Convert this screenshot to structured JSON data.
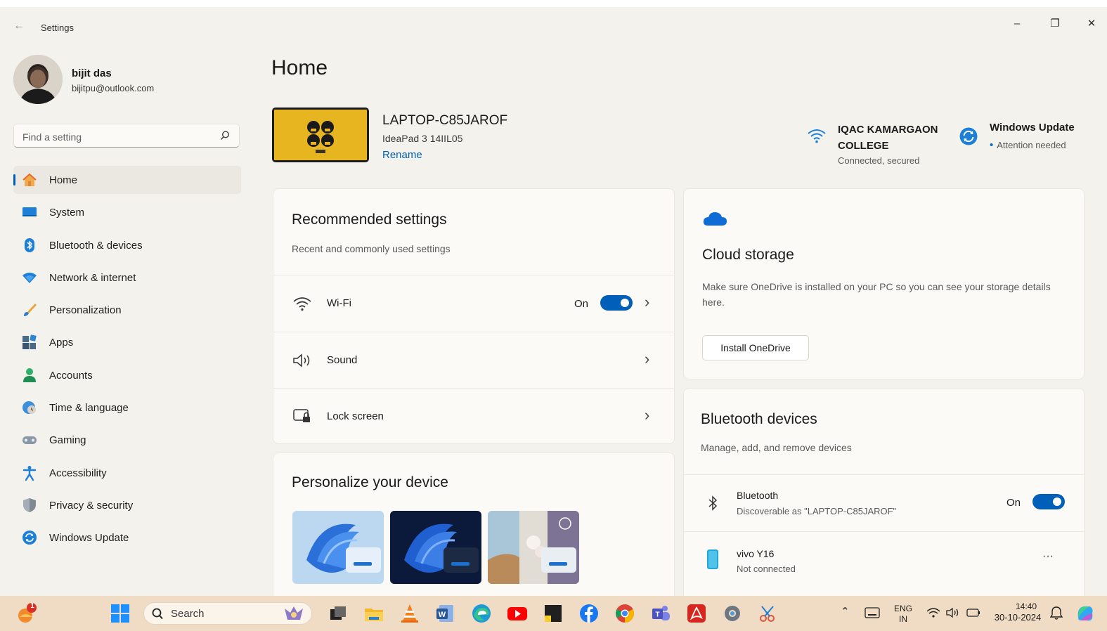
{
  "window": {
    "title": "Settings",
    "controls": [
      "–",
      "❐",
      "✕"
    ]
  },
  "profile": {
    "name": "bijit das",
    "email": "bijitpu@outlook.com"
  },
  "search": {
    "placeholder": "Find a setting"
  },
  "nav": {
    "items": [
      {
        "label": "Home",
        "icon": "home-icon",
        "active": true
      },
      {
        "label": "System",
        "icon": "system-icon"
      },
      {
        "label": "Bluetooth & devices",
        "icon": "bluetooth-icon"
      },
      {
        "label": "Network & internet",
        "icon": "network-icon"
      },
      {
        "label": "Personalization",
        "icon": "brush-icon"
      },
      {
        "label": "Apps",
        "icon": "apps-icon"
      },
      {
        "label": "Accounts",
        "icon": "account-icon"
      },
      {
        "label": "Time & language",
        "icon": "globe-clock-icon"
      },
      {
        "label": "Gaming",
        "icon": "gamepad-icon"
      },
      {
        "label": "Accessibility",
        "icon": "accessibility-icon"
      },
      {
        "label": "Privacy & security",
        "icon": "shield-icon"
      },
      {
        "label": "Windows Update",
        "icon": "update-icon"
      }
    ]
  },
  "main": {
    "title": "Home",
    "device": {
      "name": "LAPTOP-C85JAROF",
      "model": "IdeaPad 3 14IIL05",
      "rename": "Rename"
    },
    "network": {
      "name": "IQAC KAMARGAON COLLEGE",
      "status": "Connected, secured"
    },
    "update": {
      "title": "Windows Update",
      "status": "Attention needed"
    }
  },
  "recommended": {
    "title": "Recommended settings",
    "subtitle": "Recent and commonly used settings",
    "rows": [
      {
        "label": "Wi-Fi",
        "state": "On",
        "icon": "wifi-icon"
      },
      {
        "label": "Sound",
        "icon": "speaker-icon"
      },
      {
        "label": "Lock screen",
        "icon": "lock-screen-icon"
      }
    ]
  },
  "personalize": {
    "title": "Personalize your device"
  },
  "cloud": {
    "title": "Cloud storage",
    "description": "Make sure OneDrive is installed on your PC so you can see your storage details here.",
    "button": "Install OneDrive"
  },
  "bluetooth": {
    "title": "Bluetooth devices",
    "subtitle": "Manage, add, and remove devices",
    "toggle": {
      "name": "Bluetooth",
      "detail": "Discoverable as \"LAPTOP-C85JAROF\"",
      "state": "On"
    },
    "devices": [
      {
        "name": "vivo Y16",
        "status": "Not connected",
        "more": "···"
      }
    ]
  },
  "taskbar": {
    "search_label": "Search",
    "notification_count": "1",
    "lang_top": "ENG",
    "lang_bottom": "IN",
    "time": "14:40",
    "date": "30-10-2024"
  },
  "colors": {
    "accent": "#005fb8",
    "taskbar": "#f0dcc4",
    "window": "#f4f2ec"
  }
}
